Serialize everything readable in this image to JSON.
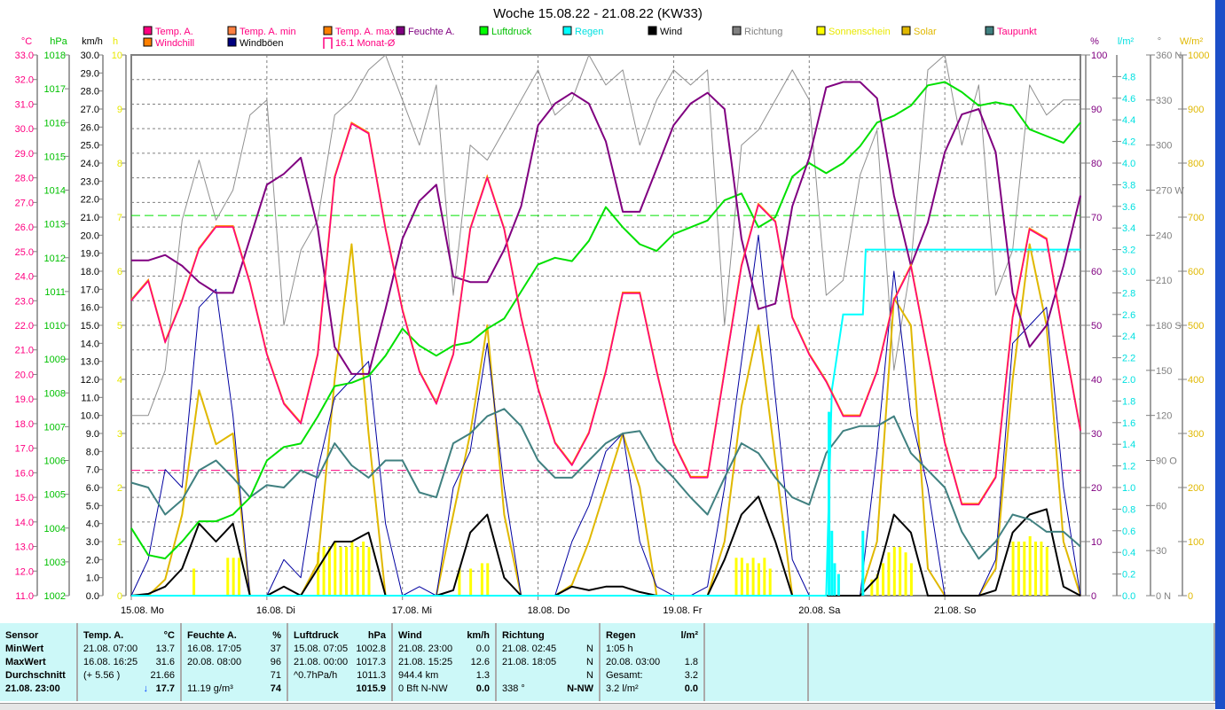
{
  "title": "Woche 15.08.22 - 21.08.22 (KW33)",
  "legend": [
    {
      "label": "Temp. A.",
      "color": "#ff0080",
      "text_color": "#ff0080"
    },
    {
      "label": "Temp. A. min",
      "color": "#ff8040",
      "text_color": "#ff0080"
    },
    {
      "label": "Temp. A. max",
      "color": "#ff8000",
      "text_color": "#ff0080"
    },
    {
      "label": "Feuchte A.",
      "color": "#800080",
      "text_color": "#800080"
    },
    {
      "label": "Luftdruck",
      "color": "#00ff00",
      "text_color": "#00c000"
    },
    {
      "label": "Regen",
      "color": "#00ffff",
      "text_color": "#00e0e0"
    },
    {
      "label": "Wind",
      "color": "#000000",
      "text_color": "#000000"
    },
    {
      "label": "Richtung",
      "color": "#808080",
      "text_color": "#808080"
    },
    {
      "label": "Sonnenschein",
      "color": "#ffff00",
      "text_color": "#e8e800"
    },
    {
      "label": "Solar",
      "color": "#e0b800",
      "text_color": "#e0b800"
    },
    {
      "label": "Taupunkt",
      "color": "#408080",
      "text_color": "#ff0080"
    },
    {
      "label": "Windchill",
      "color": "#ff8000",
      "text_color": "#ff0080"
    },
    {
      "label": "Windböen",
      "color": "#000080",
      "text_color": "#000000"
    },
    {
      "label": "16.1 Monat-Ø",
      "color": "#ff0080",
      "text_color": "#ff0080"
    }
  ],
  "chart_data": {
    "type": "line",
    "x_labels": [
      "15.08.  Mo",
      "16.08.  Di",
      "17.08.  Mi",
      "18.08.  Do",
      "19.08.  Fr",
      "20.08.  Sa",
      "21.08.  So"
    ],
    "x_step_hours": 3,
    "axes": {
      "temp": {
        "unit": "°C",
        "range": [
          11,
          33
        ],
        "color": "#ff0080"
      },
      "pressure": {
        "unit": "hPa",
        "range": [
          1002,
          1018
        ],
        "color": "#00c000"
      },
      "wind": {
        "unit": "km/h",
        "range": [
          0,
          30
        ],
        "color": "#000000"
      },
      "sunshine": {
        "unit": "h",
        "range": [
          0,
          10
        ],
        "color": "#e8e800"
      },
      "humidity": {
        "unit": "%",
        "range": [
          0,
          100
        ],
        "color": "#800080"
      },
      "rain": {
        "unit": "l/m²",
        "range": [
          0,
          4.8
        ],
        "color": "#00e0e0"
      },
      "direction": {
        "unit": "°",
        "range": [
          0,
          360
        ],
        "labels": {
          "360": "N",
          "270": "W",
          "180": "S",
          "90": "O",
          "0": "N"
        },
        "color": "#808080"
      },
      "solar": {
        "unit": "W/m²",
        "range": [
          0,
          1000
        ],
        "color": "#e0b800"
      }
    },
    "reference_lines": {
      "month_avg_temp": 16.1,
      "standard_pressure": 1013.25
    },
    "series": {
      "temp": [
        23.0,
        23.8,
        21.3,
        23.0,
        25.1,
        26.0,
        26.0,
        23.7,
        20.8,
        18.8,
        18.0,
        20.8,
        28.0,
        30.2,
        29.8,
        25.9,
        22.6,
        20.1,
        18.8,
        20.8,
        25.9,
        28.0,
        25.9,
        22.3,
        19.4,
        17.2,
        16.3,
        17.6,
        20.1,
        23.3,
        23.3,
        20.1,
        17.2,
        15.8,
        15.8,
        20.1,
        24.4,
        26.9,
        26.2,
        22.3,
        20.8,
        19.7,
        18.3,
        18.3,
        20.1,
        23.0,
        24.4,
        20.8,
        17.2,
        14.7,
        14.7,
        15.8,
        22.3,
        25.9,
        25.5,
        21.5,
        17.7
      ],
      "humidity": [
        62,
        62,
        63,
        61,
        58,
        56,
        56,
        66,
        76,
        78,
        81,
        68,
        46,
        41,
        41,
        53,
        66,
        73,
        76,
        59,
        58,
        58,
        64,
        72,
        87,
        91,
        93,
        91,
        84,
        71,
        71,
        79,
        87,
        91,
        93,
        90,
        66,
        53,
        54,
        72,
        81,
        94,
        95,
        95,
        92,
        74,
        61,
        69,
        82,
        89,
        90,
        82,
        56,
        46,
        50,
        61,
        74
      ],
      "pressure": [
        1004.0,
        1003.2,
        1003.1,
        1003.6,
        1004.2,
        1004.2,
        1004.4,
        1004.9,
        1006.0,
        1006.4,
        1006.5,
        1007.3,
        1008.2,
        1008.3,
        1008.5,
        1009.1,
        1009.9,
        1009.4,
        1009.1,
        1009.4,
        1009.5,
        1009.9,
        1010.2,
        1011.0,
        1011.8,
        1012.0,
        1011.9,
        1012.5,
        1013.5,
        1012.9,
        1012.4,
        1012.2,
        1012.7,
        1012.9,
        1013.1,
        1013.7,
        1013.9,
        1012.9,
        1013.2,
        1014.4,
        1014.8,
        1014.5,
        1014.8,
        1015.3,
        1016.0,
        1016.2,
        1016.5,
        1017.1,
        1017.2,
        1016.9,
        1016.5,
        1016.6,
        1016.5,
        1015.8,
        1015.6,
        1015.4,
        1016.0
      ],
      "dewpoint": [
        15.6,
        15.4,
        14.3,
        14.9,
        16.1,
        16.5,
        15.8,
        15.0,
        15.5,
        15.4,
        16.1,
        15.8,
        17.2,
        16.3,
        15.8,
        16.5,
        16.5,
        15.2,
        15.0,
        17.2,
        17.6,
        18.3,
        18.6,
        17.9,
        16.5,
        15.8,
        15.8,
        16.5,
        17.2,
        17.6,
        17.7,
        16.5,
        15.8,
        15.0,
        14.3,
        15.8,
        17.2,
        16.8,
        15.8,
        15.0,
        14.7,
        16.8,
        17.7,
        17.9,
        17.9,
        18.3,
        16.8,
        16.1,
        15.4,
        13.6,
        12.5,
        13.2,
        14.3,
        14.1,
        13.6,
        13.6,
        13.0
      ],
      "wind": [
        0,
        0.1,
        0.5,
        1.5,
        4.0,
        3.0,
        4.0,
        0,
        0,
        0.5,
        0,
        1.5,
        3.0,
        3.0,
        3.5,
        0,
        0,
        0,
        0,
        0.3,
        3.5,
        4.5,
        1.0,
        0,
        0,
        0,
        0.5,
        0.3,
        0.5,
        0.5,
        0.2,
        0,
        0,
        0,
        0,
        2.0,
        4.5,
        5.5,
        3.0,
        0,
        0,
        0,
        0,
        0,
        1.0,
        4.5,
        3.5,
        0,
        0,
        0,
        0,
        0.3,
        3.5,
        4.5,
        4.8,
        0.5,
        0
      ],
      "gusts": [
        0,
        2,
        7,
        6,
        16,
        17,
        10,
        0,
        0,
        2,
        1,
        7,
        11,
        12,
        13,
        4,
        0,
        0.5,
        0,
        6,
        8,
        14,
        6,
        0,
        0,
        0,
        3,
        5,
        8,
        9,
        3,
        0.5,
        0,
        0,
        0.5,
        6,
        13,
        20,
        11,
        2,
        0,
        0,
        0,
        0,
        8,
        18,
        10,
        6,
        0,
        0,
        0,
        2,
        14,
        15,
        16,
        6,
        0
      ],
      "solar": [
        0,
        0,
        30,
        150,
        380,
        280,
        300,
        0,
        0,
        0,
        0,
        60,
        400,
        650,
        300,
        0,
        0,
        0,
        0,
        150,
        300,
        500,
        150,
        0,
        0,
        0,
        20,
        100,
        200,
        300,
        200,
        0,
        0,
        0,
        0,
        100,
        350,
        500,
        250,
        0,
        0,
        0,
        0,
        0,
        100,
        550,
        500,
        50,
        0,
        0,
        0,
        50,
        400,
        650,
        500,
        100,
        0
      ],
      "direction": [
        120,
        120,
        150,
        250,
        290,
        250,
        270,
        320,
        330,
        180,
        230,
        250,
        320,
        330,
        350,
        360,
        330,
        300,
        340,
        200,
        300,
        290,
        310,
        330,
        350,
        320,
        330,
        360,
        340,
        350,
        300,
        330,
        350,
        340,
        350,
        180,
        300,
        310,
        330,
        350,
        330,
        200,
        210,
        280,
        310,
        150,
        220,
        350,
        360,
        300,
        340,
        200,
        230,
        340,
        320,
        330,
        330
      ],
      "rain_cumulative": [
        [
          0,
          0
        ],
        [
          123,
          0
        ],
        [
          124,
          1.9
        ],
        [
          126,
          2.6
        ],
        [
          129.5,
          2.6
        ],
        [
          130,
          3.2
        ],
        [
          168,
          3.2
        ]
      ],
      "rain_bars": [
        [
          123.5,
          1.7
        ],
        [
          124,
          0.6
        ],
        [
          124.5,
          0.3
        ],
        [
          125.2,
          0.2
        ],
        [
          129.5,
          0.6
        ]
      ],
      "sunshine": [
        [
          11,
          0.5
        ],
        [
          17,
          0.7
        ],
        [
          18,
          0.7
        ],
        [
          19,
          0.7
        ],
        [
          33,
          0.8
        ],
        [
          34,
          0.9
        ],
        [
          35,
          0.9
        ],
        [
          36,
          1.0
        ],
        [
          37,
          0.9
        ],
        [
          38,
          0.9
        ],
        [
          39,
          1.0
        ],
        [
          40,
          0.9
        ],
        [
          41,
          1.0
        ],
        [
          42,
          0.9
        ],
        [
          58,
          0.5
        ],
        [
          60,
          0.5
        ],
        [
          62,
          0.6
        ],
        [
          63,
          0.6
        ],
        [
          107,
          0.7
        ],
        [
          108,
          0.7
        ],
        [
          109,
          0.6
        ],
        [
          110,
          0.7
        ],
        [
          111,
          0.6
        ],
        [
          112,
          0.7
        ],
        [
          113,
          0.5
        ],
        [
          131,
          0.3
        ],
        [
          132,
          0.4
        ],
        [
          133,
          0.6
        ],
        [
          134,
          0.8
        ],
        [
          135,
          0.9
        ],
        [
          136,
          0.9
        ],
        [
          137,
          0.8
        ],
        [
          138,
          0.6
        ],
        [
          156,
          1.0
        ],
        [
          157,
          1.0
        ],
        [
          158,
          1.0
        ],
        [
          159,
          1.1
        ],
        [
          160,
          1.0
        ],
        [
          161,
          1.0
        ],
        [
          162,
          0.9
        ]
      ]
    }
  },
  "table": {
    "sensor": {
      "h": "Sensor",
      "r1": "MinWert",
      "r2": "MaxWert",
      "r3": "Durchschnitt",
      "r4": "21.08.  23:00"
    },
    "temp": {
      "h": "Temp. A.",
      "u": "°C",
      "r1l": "21.08.  07:00",
      "r1r": "13.7",
      "r2l": "16.08.  16:25",
      "r2r": "31.6",
      "r3l": "(+ 5.56 )",
      "r3r": "21.66",
      "r4l": "",
      "r4r": "17.7",
      "trend": "↓"
    },
    "hum": {
      "h": "Feuchte A.",
      "u": "%",
      "r1l": "16.08.  17:05",
      "r1r": "37",
      "r2l": "20.08.  08:00",
      "r2r": "96",
      "r3l": "",
      "r3r": "71",
      "r4l": "11.19 g/m³",
      "r4r": "74"
    },
    "press": {
      "h": "Luftdruck",
      "u": "hPa",
      "r1l": "15.08.  07:05",
      "r1r": "1002.8",
      "r2l": "21.08.  00:00",
      "r2r": "1017.3",
      "r3l": "^0.7hPa/h",
      "r3r": "1011.3",
      "r4l": "",
      "r4r": "1015.9"
    },
    "wind": {
      "h": "Wind",
      "u": "km/h",
      "r1l": "21.08.  23:00",
      "r1r": "0.0",
      "r2l": "21.08.  15:25",
      "r2r": "12.6",
      "r3l": "944.4 km",
      "r3r": "1.3",
      "r4l": "0 Bft N-NW",
      "r4r": "0.0"
    },
    "dir": {
      "h": "Richtung",
      "u": "",
      "r1l": "21.08.  02:45",
      "r1r": "N",
      "r2l": "21.08.  18:05",
      "r2r": "N",
      "r3l": "",
      "r3r": "N",
      "r4l": "338 °",
      "r4r": "N-NW"
    },
    "rain": {
      "h": "Regen",
      "u": "l/m²",
      "r1l": "1:05 h",
      "r1r": "",
      "r2l": "20.08.  03:00",
      "r2r": "1.8",
      "r3l": "Gesamt:",
      "r3r": "3.2",
      "r4l": "3.2 l/m²",
      "r4r": "0.0"
    }
  }
}
